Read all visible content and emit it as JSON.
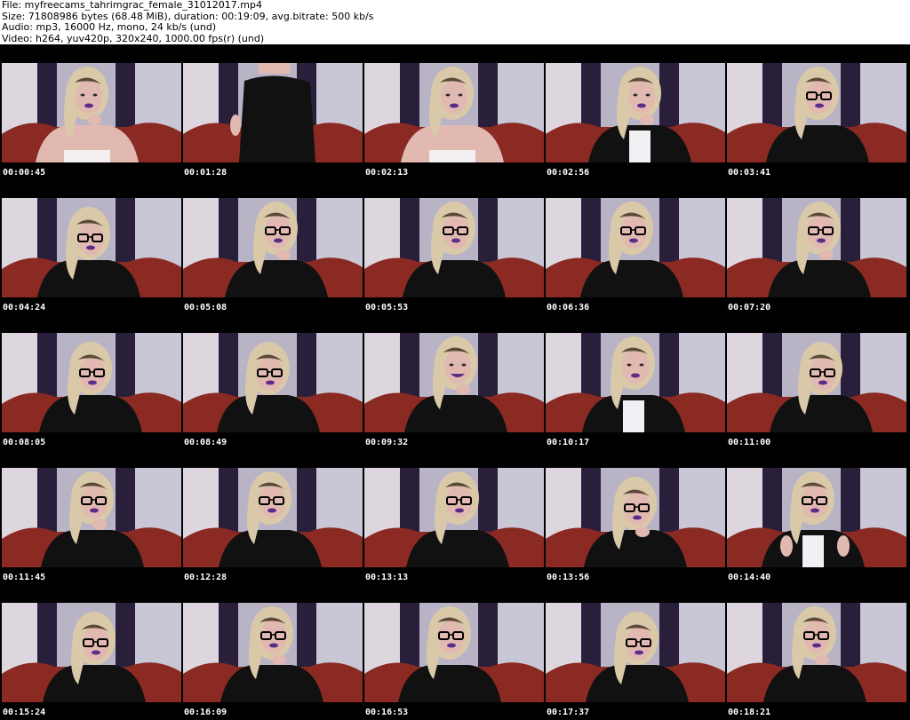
{
  "header": {
    "file_line": "File: myfreecams_tahrimgrac_female_31012017.mp4",
    "size_line": "Size: 71808986 bytes (68.48 MiB), duration: 00:19:09, avg.bitrate: 500 kb/s",
    "audio_line": "Audio: mp3, 16000 Hz, mono, 24 kb/s (und)",
    "video_line": "Video: h264, yuv420p, 320x240, 1000.00 fps(r) (und)"
  },
  "colors": {
    "background": "#000000",
    "curtain_light": "#ddd6df",
    "curtain_dark": "#2a1f3a",
    "chair_red": "#8a2a22",
    "skin": "#e2b9b0",
    "hair_blonde": "#d9c9a8",
    "clothing_black": "#111111",
    "lips_purple": "#5a2d8a",
    "timestamp_text": "#ffffff"
  },
  "thumbnails": [
    {
      "timestamp": "00:00:45",
      "variant": "bare"
    },
    {
      "timestamp": "00:01:28",
      "variant": "standing"
    },
    {
      "timestamp": "00:02:13",
      "variant": "bare"
    },
    {
      "timestamp": "00:02:56",
      "variant": "white-top"
    },
    {
      "timestamp": "00:03:41",
      "variant": "glasses"
    },
    {
      "timestamp": "00:04:24",
      "variant": "glasses-down"
    },
    {
      "timestamp": "00:05:08",
      "variant": "glasses"
    },
    {
      "timestamp": "00:05:53",
      "variant": "glasses"
    },
    {
      "timestamp": "00:06:36",
      "variant": "glasses"
    },
    {
      "timestamp": "00:07:20",
      "variant": "glasses"
    },
    {
      "timestamp": "00:08:05",
      "variant": "glasses-down"
    },
    {
      "timestamp": "00:08:49",
      "variant": "glasses-down"
    },
    {
      "timestamp": "00:09:32",
      "variant": "smile"
    },
    {
      "timestamp": "00:10:17",
      "variant": "white-top"
    },
    {
      "timestamp": "00:11:00",
      "variant": "glasses-down"
    },
    {
      "timestamp": "00:11:45",
      "variant": "glasses"
    },
    {
      "timestamp": "00:12:28",
      "variant": "glasses"
    },
    {
      "timestamp": "00:13:13",
      "variant": "glasses"
    },
    {
      "timestamp": "00:13:56",
      "variant": "glasses-down"
    },
    {
      "timestamp": "00:14:40",
      "variant": "hands-up"
    },
    {
      "timestamp": "00:15:24",
      "variant": "glasses-down"
    },
    {
      "timestamp": "00:16:09",
      "variant": "glasses"
    },
    {
      "timestamp": "00:16:53",
      "variant": "glasses"
    },
    {
      "timestamp": "00:17:37",
      "variant": "glasses-down"
    },
    {
      "timestamp": "00:18:21",
      "variant": "glasses"
    }
  ]
}
